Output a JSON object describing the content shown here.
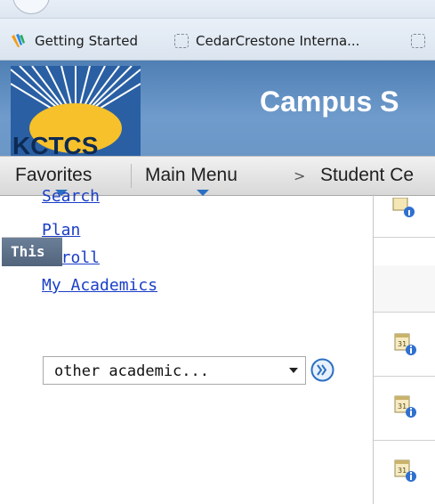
{
  "bookmarks": [
    {
      "label": "Getting Started",
      "icon": "bookmark-logo-icon"
    },
    {
      "label": "CedarCrestone Interna...",
      "icon": "dashed-bookmark-icon"
    },
    {
      "label": "",
      "icon": "dashed-bookmark-icon"
    }
  ],
  "banner": {
    "logo_text": "KCTCS",
    "title": "Campus S"
  },
  "nav": {
    "favorites": "Favorites",
    "main_menu": "Main Menu",
    "separator": ">",
    "student_center": "Student Ce"
  },
  "links": [
    "Search",
    "Plan",
    "Enroll",
    "My Academics"
  ],
  "select": {
    "value": "other academic..."
  },
  "right_panel": {
    "header": "This"
  },
  "colors": {
    "banner": "#5f8cc0",
    "link": "#1a3ec7",
    "nav_caret": "#2b6fc2",
    "panel_header": "#5b6e86"
  }
}
